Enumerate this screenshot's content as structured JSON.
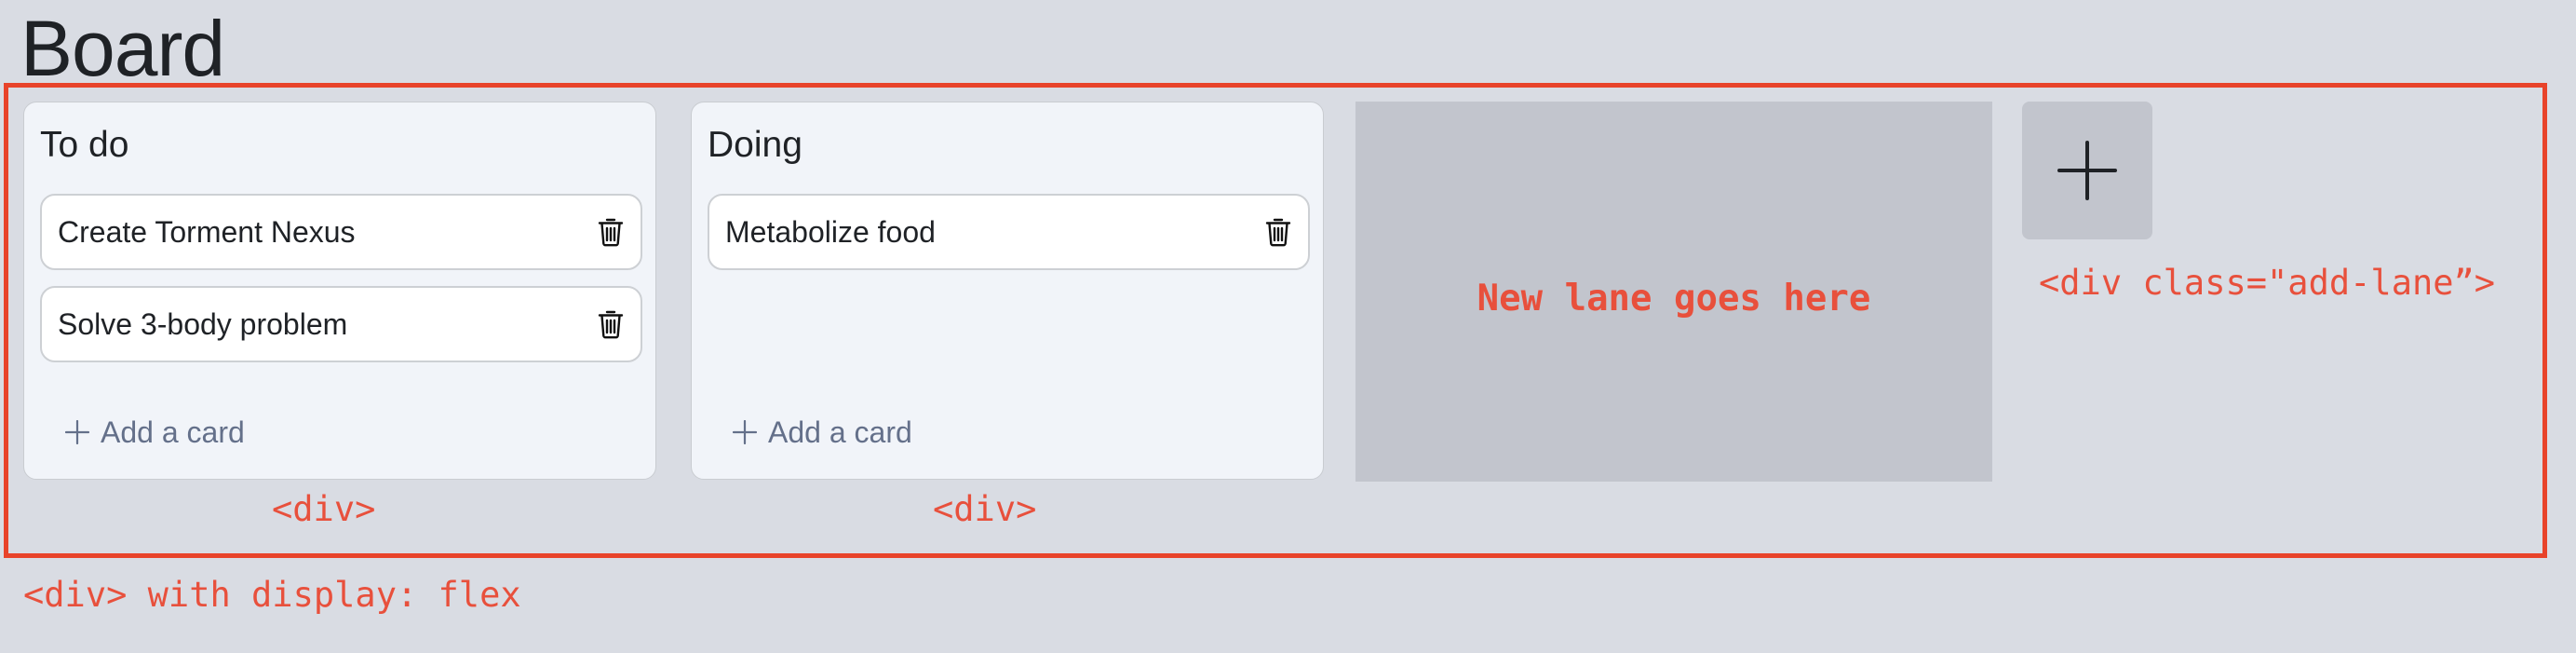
{
  "page": {
    "title": "Board"
  },
  "board": {
    "lanes": [
      {
        "title": "To do",
        "cards": [
          {
            "text": "Create Torment Nexus",
            "action_icon": "trash-icon"
          },
          {
            "text": "Solve 3-body problem",
            "action_icon": "trash-icon"
          }
        ],
        "add_card_label": "Add a card",
        "add_card_icon": "plus-icon"
      },
      {
        "title": "Doing",
        "cards": [
          {
            "text": "Metabolize food",
            "action_icon": "trash-icon"
          }
        ],
        "add_card_label": "Add a card",
        "add_card_icon": "plus-icon"
      }
    ],
    "placeholder_lane": {
      "label": "New lane goes here"
    },
    "add_lane_button": {
      "icon": "plus-icon"
    }
  },
  "annotations": {
    "lane_div_1": "<div>",
    "lane_div_2": "<div>",
    "add_lane_div": "<div class=\"add-lane”>",
    "flex_container": "<div> with display: flex"
  },
  "colors": {
    "background": "#d9dce3",
    "lane_background": "#f1f4f9",
    "card_background": "#ffffff",
    "placeholder_background": "#c2c5cd",
    "annotation_red": "#e8432a",
    "add_card_text": "#64708a",
    "text_primary": "#1f2226"
  }
}
